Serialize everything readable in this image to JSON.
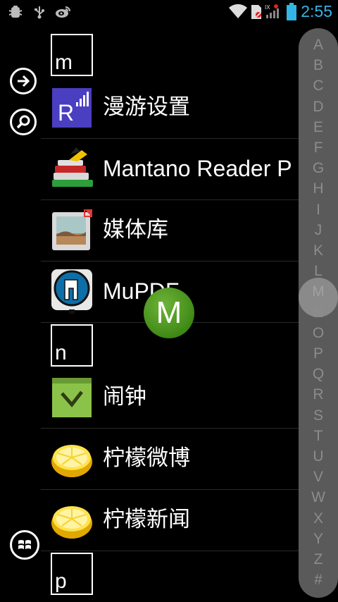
{
  "status_bar": {
    "time": "2:55",
    "left_icons": [
      "bug-icon",
      "usb-icon",
      "weibo-icon"
    ],
    "right_icons": [
      "wifi-icon",
      "no-sim-icon",
      "signal-icon",
      "battery-icon"
    ],
    "accent_color": "#33b5e5"
  },
  "nav": {
    "arrow_icon": "arrow-right-icon",
    "search_icon": "search-icon",
    "windows_icon": "windows-logo-icon"
  },
  "list": {
    "section_m": "m",
    "section_n": "n",
    "section_p": "p",
    "apps": [
      {
        "label": "漫游设置",
        "icon": "roaming-settings-icon"
      },
      {
        "label": "Mantano Reader P",
        "icon": "books-icon"
      },
      {
        "label": "媒体库",
        "icon": "media-library-icon"
      },
      {
        "label": "MuPDF",
        "icon": "mupdf-icon"
      },
      {
        "label": "闹钟",
        "icon": "alarm-clock-icon"
      },
      {
        "label": "柠檬微博",
        "icon": "lemon-icon"
      },
      {
        "label": "柠檬新闻",
        "icon": "lemon-icon"
      }
    ]
  },
  "index_bar": {
    "letters": [
      "A",
      "B",
      "C",
      "D",
      "E",
      "F",
      "G",
      "H",
      "I",
      "J",
      "K",
      "L",
      "M",
      "N",
      "O",
      "P",
      "Q",
      "R",
      "S",
      "T",
      "U",
      "V",
      "W",
      "X",
      "Y",
      "Z",
      "#"
    ],
    "selected": "M"
  },
  "badge": {
    "letter": "M",
    "color": "#4a9a1f"
  }
}
